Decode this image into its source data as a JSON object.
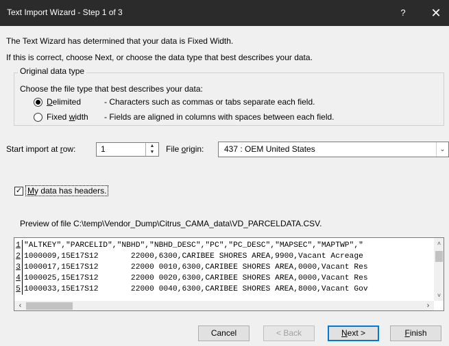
{
  "window": {
    "title": "Text Import Wizard - Step 1 of 3",
    "help_glyph": "?",
    "close_glyph": "✕"
  },
  "intro": {
    "line1": "The Text Wizard has determined that your data is Fixed Width.",
    "line2": "If this is correct, choose Next, or choose the data type that best describes your data."
  },
  "original_type": {
    "legend": "Original data type",
    "prompt": "Choose the file type that best describes your data:",
    "options": [
      {
        "label_pre": "",
        "label_key": "D",
        "label_post": "elimited",
        "description": "- Characters such as commas or tabs separate each field.",
        "selected": true
      },
      {
        "label_pre": "Fixed ",
        "label_key": "w",
        "label_post": "idth",
        "description": "- Fields are aligned in columns with spaces between each field.",
        "selected": false
      }
    ]
  },
  "start_row": {
    "label_pre": "Start import at ",
    "label_key": "r",
    "label_post": "ow:",
    "value": "1"
  },
  "file_origin": {
    "label_pre": "File ",
    "label_key": "o",
    "label_post": "rigin:",
    "value": "437 : OEM United States"
  },
  "headers": {
    "checked": true,
    "check_glyph": "✓",
    "label_key": "M",
    "label_post": "y data has headers."
  },
  "preview": {
    "label": "Preview of file C:\\temp\\Vendor_Dump\\Citrus_CAMA_data\\VD_PARCELDATA.CSV.",
    "rows": [
      {
        "num": "1",
        "text": "\"ALTKEY\",\"PARCELID\",\"NBHD\",\"NBHD_DESC\",\"PC\",\"PC_DESC\",\"MAPSEC\",\"MAPTWP\",\""
      },
      {
        "num": "2",
        "text": "1000009,15E17S12       22000,6300,CARIBEE SHORES AREA,9900,Vacant Acreage"
      },
      {
        "num": "3",
        "text": "1000017,15E17S12       22000 0010,6300,CARIBEE SHORES AREA,0000,Vacant Res"
      },
      {
        "num": "4",
        "text": "1000025,15E17S12       22000 0020,6300,CARIBEE SHORES AREA,0000,Vacant Res"
      },
      {
        "num": "5",
        "text": "1000033,15E17S12       22000 0040,6300,CARIBEE SHORES AREA,8000,Vacant Gov"
      }
    ]
  },
  "buttons": {
    "cancel": "Cancel",
    "back": "< Back",
    "next_key": "N",
    "next_post": "ext >",
    "finish_key": "F",
    "finish_post": "inish"
  }
}
